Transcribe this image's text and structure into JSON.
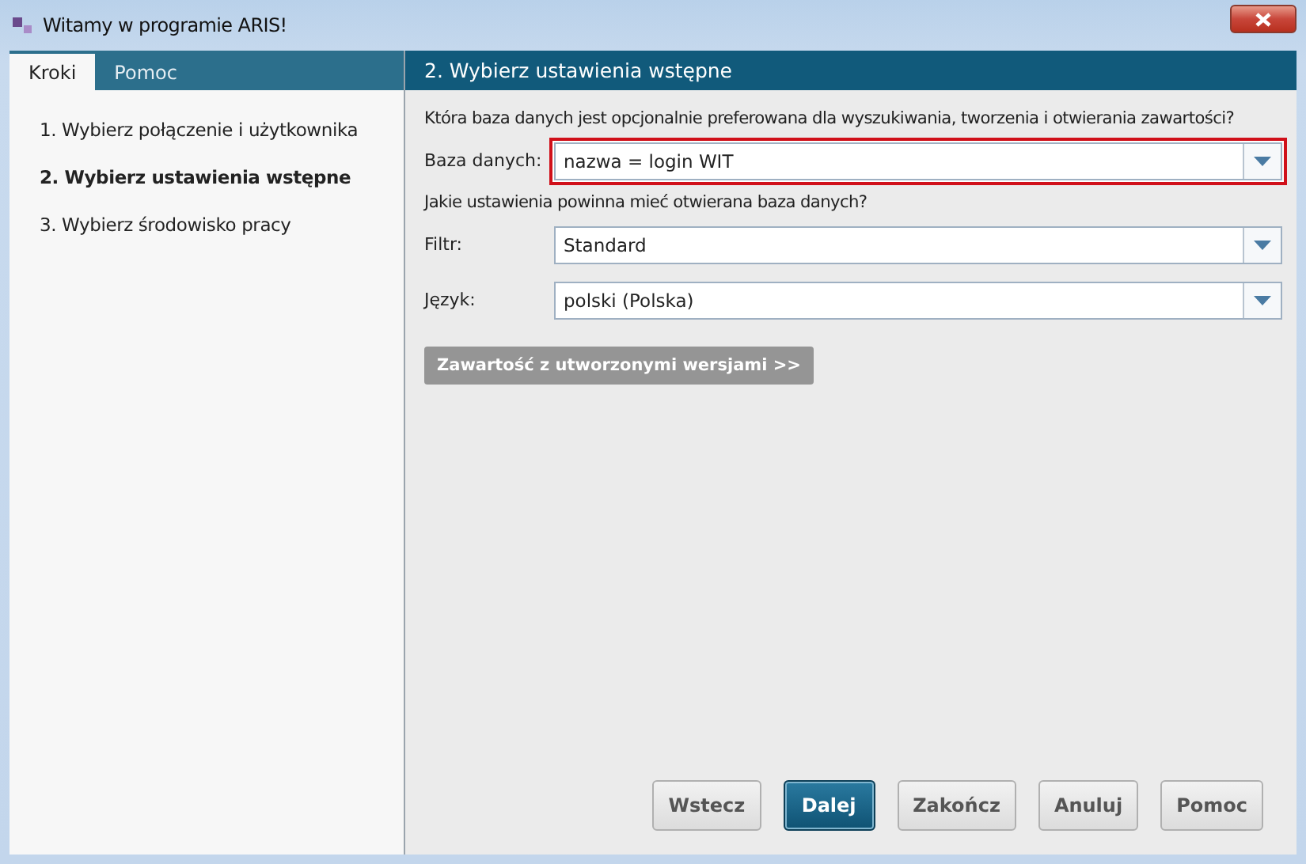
{
  "window": {
    "title": "Witamy w programie ARIS!"
  },
  "tabs": [
    {
      "label": "Kroki",
      "selected": true
    },
    {
      "label": "Pomoc",
      "selected": false
    }
  ],
  "steps": [
    {
      "label": "1. Wybierz połączenie i użytkownika",
      "selected": false
    },
    {
      "label": "2. Wybierz ustawienia wstępne",
      "selected": true
    },
    {
      "label": "3. Wybierz środowisko pracy",
      "selected": false
    }
  ],
  "page": {
    "title": "2. Wybierz ustawienia wstępne",
    "question_1": "Która baza danych jest opcjonalnie preferowana dla wyszukiwania, tworzenia i otwierania zawartości?",
    "database": {
      "label": "Baza danych:",
      "value": "nazwa = login WIT",
      "error": true
    },
    "question_2": "Jakie ustawienia powinna mieć otwierana baza danych?",
    "fields": [
      {
        "label": "Filtr:",
        "value": "Standard",
        "error": false
      },
      {
        "label": "Język:",
        "value": "polski (Polska)",
        "error": false
      }
    ],
    "versions_button": {
      "label": "Zawartość z utworzonymi wersjami >>",
      "disabled": true
    }
  },
  "buttons": [
    {
      "label": "Wstecz",
      "primary": false
    },
    {
      "label": "Dalej",
      "primary": true
    },
    {
      "label": "Zakończ",
      "primary": false
    },
    {
      "label": "Anuluj",
      "primary": false
    },
    {
      "label": "Pomoc",
      "primary": false
    }
  ]
}
